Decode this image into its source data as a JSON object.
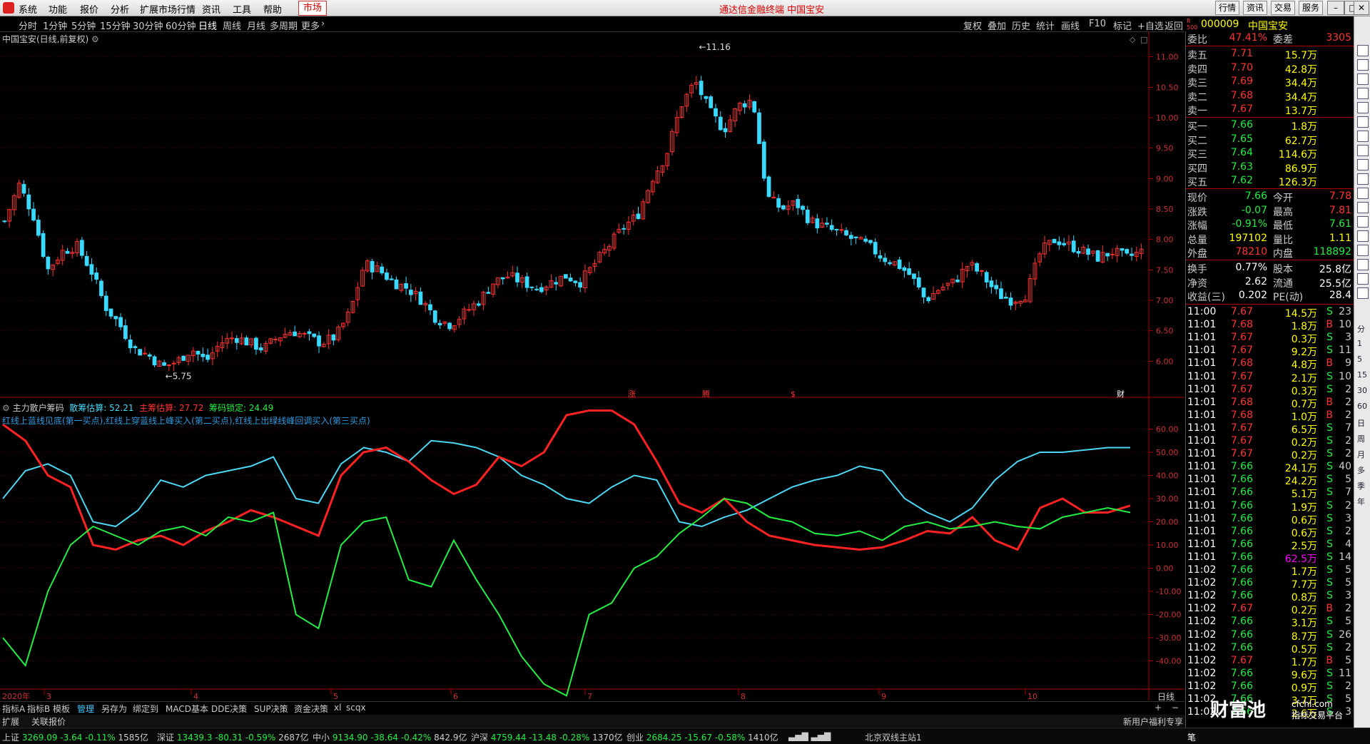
{
  "menubar": {
    "items": [
      "系统",
      "功能",
      "报价",
      "分析",
      "扩展市场行情",
      "资讯",
      "工具",
      "帮助"
    ],
    "market_tab": "市场",
    "title": "通达信金融终端  中国宝安",
    "right_buttons": [
      "行情",
      "资讯",
      "交易",
      "服务"
    ]
  },
  "periodbar": {
    "periods": [
      "分时",
      "1分钟",
      "5分钟",
      "15分钟",
      "30分钟",
      "60分钟",
      "日线",
      "周线",
      "月线",
      "多周期",
      "更多"
    ],
    "active": "日线",
    "right_items": [
      "复权",
      "叠加",
      "历史",
      "统计",
      "画线",
      "F10",
      "标记",
      "+自选",
      "返回"
    ]
  },
  "main_chart": {
    "title": "中国宝安(日线,前复权)",
    "high_label": "11.16",
    "low_label": "5.75",
    "price_axis": [
      "11.00",
      "10.50",
      "10.00",
      "9.50",
      "9.00",
      "8.50",
      "8.00",
      "7.50",
      "7.00",
      "6.50",
      "6.00"
    ],
    "event_marks": [
      "涨",
      "腾",
      "$",
      "财"
    ]
  },
  "chart_data": [
    {
      "type": "candlestick",
      "title": "中国宝安(日线,前复权)",
      "ylim": [
        5.5,
        11.3
      ],
      "note_points": {
        "high": 11.16,
        "low": 5.75
      },
      "close_path": [
        8.3,
        8.9,
        8.4,
        7.5,
        7.8,
        7.9,
        7.5,
        6.9,
        6.6,
        6.2,
        6.1,
        5.9,
        6.0,
        6.2,
        6.0,
        6.3,
        6.4,
        6.3,
        6.2,
        6.4,
        6.5,
        6.4,
        6.3,
        6.4,
        6.8,
        7.6,
        7.5,
        7.3,
        7.2,
        7.0,
        6.7,
        6.6,
        6.8,
        7.0,
        7.3,
        7.4,
        7.3,
        7.2,
        7.3,
        7.4,
        7.3,
        7.6,
        7.9,
        8.2,
        8.4,
        9.0,
        9.4,
        10.2,
        10.6,
        10.1,
        9.8,
        10.2,
        10.3,
        8.7,
        8.5,
        8.6,
        8.3,
        8.2,
        8.1,
        8.0,
        7.9,
        7.7,
        7.6,
        7.4,
        7.0,
        7.2,
        7.3,
        7.6,
        7.4,
        7.1,
        7.0,
        7.1,
        7.8,
        8.0,
        7.9,
        7.8,
        7.7,
        7.8,
        7.7,
        7.8
      ]
    },
    {
      "type": "line",
      "title": "主力散户筹码",
      "ylim": [
        -50,
        70
      ],
      "ticks": [
        "60.00",
        "50.00",
        "40.00",
        "30.00",
        "20.00",
        "10.00",
        "0.00",
        "-10.00",
        "-20.00",
        "-30.00",
        "-40.00"
      ],
      "series": [
        {
          "name": "散筹估算",
          "color": "#4cd7f5",
          "last": 52.21,
          "values": [
            30,
            42,
            45,
            40,
            20,
            18,
            25,
            38,
            35,
            40,
            42,
            44,
            48,
            30,
            28,
            45,
            52,
            50,
            46,
            55,
            54,
            52,
            48,
            40,
            36,
            30,
            28,
            35,
            40,
            38,
            20,
            18,
            22,
            25,
            30,
            35,
            38,
            40,
            44,
            42,
            30,
            24,
            20,
            26,
            38,
            46,
            50,
            50,
            51,
            52,
            52
          ]
        },
        {
          "name": "主筹估算",
          "color": "#ff2222",
          "last": 27.72,
          "values": [
            62,
            55,
            40,
            35,
            10,
            8,
            12,
            14,
            10,
            16,
            20,
            25,
            22,
            18,
            14,
            40,
            50,
            52,
            46,
            38,
            32,
            36,
            48,
            44,
            50,
            66,
            68,
            68,
            62,
            46,
            28,
            24,
            30,
            20,
            14,
            12,
            10,
            9,
            8,
            9,
            12,
            16,
            15,
            22,
            12,
            8,
            26,
            30,
            24,
            24,
            27
          ]
        },
        {
          "name": "筹码锁定",
          "color": "#22ee44",
          "last": 24.49,
          "values": [
            -30,
            -42,
            -10,
            10,
            18,
            14,
            10,
            16,
            18,
            14,
            22,
            20,
            24,
            -20,
            -26,
            10,
            20,
            22,
            -5,
            -8,
            12,
            -5,
            -20,
            -38,
            -50,
            -55,
            -20,
            -15,
            0,
            5,
            15,
            22,
            30,
            28,
            22,
            20,
            15,
            14,
            16,
            12,
            18,
            20,
            17,
            18,
            20,
            18,
            17,
            22,
            24,
            26,
            24
          ]
        }
      ]
    }
  ],
  "indicator": {
    "name": "主力散户筹码",
    "retail_label": "散筹估算:",
    "retail_value": "52.21",
    "main_label": "主筹估算:",
    "main_value": "27.72",
    "lock_label": "筹码锁定:",
    "lock_value": "24.49",
    "description": "红线上蓝线见底(第一买点),红线上穿蓝线上峰买入(第二买点),红线上出绿线峰回调买入(第三买点)"
  },
  "x_axis": {
    "year": "2020年",
    "months": [
      "3",
      "4",
      "5",
      "6",
      "7",
      "8",
      "9",
      "10"
    ],
    "period_label": "日线"
  },
  "tool_tabs": [
    "指标A",
    "指标B",
    "模板",
    "管理",
    "另存为",
    "绑定到",
    "MACD基本",
    "DDE决策",
    "SUP决策",
    "资金决策",
    "xl",
    "scqx"
  ],
  "tool_tab_active": "管理",
  "ext_bar": [
    "扩展",
    "关联报价"
  ],
  "quote_panel": {
    "code": "000009",
    "name": "中国宝安",
    "wb_label": "委比",
    "wb_value": "47.41%",
    "wc_label": "委差",
    "wc_value": "3305",
    "asks": [
      {
        "label": "卖五",
        "price": "7.71",
        "vol": "15.7万"
      },
      {
        "label": "卖四",
        "price": "7.70",
        "vol": "42.8万"
      },
      {
        "label": "卖三",
        "price": "7.69",
        "vol": "34.4万"
      },
      {
        "label": "卖二",
        "price": "7.68",
        "vol": "34.4万"
      },
      {
        "label": "卖一",
        "price": "7.67",
        "vol": "13.7万"
      }
    ],
    "bids": [
      {
        "label": "买一",
        "price": "7.66",
        "vol": "1.8万"
      },
      {
        "label": "买二",
        "price": "7.65",
        "vol": "62.7万"
      },
      {
        "label": "买三",
        "price": "7.64",
        "vol": "114.6万"
      },
      {
        "label": "买四",
        "price": "7.63",
        "vol": "86.9万"
      },
      {
        "label": "买五",
        "price": "7.62",
        "vol": "126.3万"
      }
    ],
    "stats": [
      {
        "l1": "现价",
        "v1": "7.66",
        "l2": "今开",
        "v2": "7.78"
      },
      {
        "l1": "涨跌",
        "v1": "-0.07",
        "l2": "最高",
        "v2": "7.81"
      },
      {
        "l1": "涨幅",
        "v1": "-0.91%",
        "l2": "最低",
        "v2": "7.61"
      },
      {
        "l1": "总量",
        "v1": "197102",
        "l2": "量比",
        "v2": "1.11"
      },
      {
        "l1": "外盘",
        "v1": "78210",
        "l2": "内盘",
        "v2": "118892"
      }
    ],
    "stats2": [
      {
        "l1": "换手",
        "v1": "0.77%",
        "l2": "股本",
        "v2": "25.8亿"
      },
      {
        "l1": "净资",
        "v1": "2.62",
        "l2": "流通",
        "v2": "25.5亿"
      },
      {
        "l1": "收益(三)",
        "v1": "0.202",
        "l2": "PE(动)",
        "v2": "28.4"
      }
    ],
    "ticks": [
      {
        "t": "11:00",
        "p": "7.67",
        "v": "14.5万",
        "s": "S",
        "n": "23"
      },
      {
        "t": "11:01",
        "p": "7.68",
        "v": "1.8万",
        "s": "B",
        "n": "10"
      },
      {
        "t": "11:01",
        "p": "7.67",
        "v": "0.3万",
        "s": "S",
        "n": "3"
      },
      {
        "t": "11:01",
        "p": "7.67",
        "v": "9.2万",
        "s": "S",
        "n": "11"
      },
      {
        "t": "11:01",
        "p": "7.68",
        "v": "4.8万",
        "s": "B",
        "n": "9"
      },
      {
        "t": "11:01",
        "p": "7.67",
        "v": "2.1万",
        "s": "S",
        "n": "10"
      },
      {
        "t": "11:01",
        "p": "7.67",
        "v": "0.3万",
        "s": "S",
        "n": "2"
      },
      {
        "t": "11:01",
        "p": "7.68",
        "v": "0.7万",
        "s": "B",
        "n": "2"
      },
      {
        "t": "11:01",
        "p": "7.68",
        "v": "1.0万",
        "s": "B",
        "n": "2"
      },
      {
        "t": "11:01",
        "p": "7.67",
        "v": "6.5万",
        "s": "S",
        "n": "7"
      },
      {
        "t": "11:01",
        "p": "7.67",
        "v": "0.2万",
        "s": "S",
        "n": "2"
      },
      {
        "t": "11:01",
        "p": "7.67",
        "v": "0.2万",
        "s": "S",
        "n": "2"
      },
      {
        "t": "11:01",
        "p": "7.66",
        "v": "24.1万",
        "s": "S",
        "n": "40"
      },
      {
        "t": "11:01",
        "p": "7.66",
        "v": "24.2万",
        "s": "S",
        "n": "5"
      },
      {
        "t": "11:01",
        "p": "7.66",
        "v": "5.1万",
        "s": "S",
        "n": "7"
      },
      {
        "t": "11:01",
        "p": "7.66",
        "v": "1.9万",
        "s": "S",
        "n": "2"
      },
      {
        "t": "11:01",
        "p": "7.66",
        "v": "0.6万",
        "s": "S",
        "n": "3"
      },
      {
        "t": "11:01",
        "p": "7.66",
        "v": "0.6万",
        "s": "S",
        "n": "2"
      },
      {
        "t": "11:01",
        "p": "7.66",
        "v": "2.5万",
        "s": "S",
        "n": "4"
      },
      {
        "t": "11:01",
        "p": "7.66",
        "v": "62.5万",
        "s": "S",
        "n": "14"
      },
      {
        "t": "11:02",
        "p": "7.66",
        "v": "1.7万",
        "s": "S",
        "n": "5"
      },
      {
        "t": "11:02",
        "p": "7.66",
        "v": "7.7万",
        "s": "S",
        "n": "5"
      },
      {
        "t": "11:02",
        "p": "7.66",
        "v": "0.8万",
        "s": "S",
        "n": "3"
      },
      {
        "t": "11:02",
        "p": "7.67",
        "v": "0.2万",
        "s": "B",
        "n": "2"
      },
      {
        "t": "11:02",
        "p": "7.66",
        "v": "3.1万",
        "s": "S",
        "n": "5"
      },
      {
        "t": "11:02",
        "p": "7.66",
        "v": "8.7万",
        "s": "S",
        "n": "26"
      },
      {
        "t": "11:02",
        "p": "7.66",
        "v": "0.5万",
        "s": "S",
        "n": "2"
      },
      {
        "t": "11:02",
        "p": "7.67",
        "v": "1.7万",
        "s": "B",
        "n": "5"
      },
      {
        "t": "11:02",
        "p": "7.66",
        "v": "9.6万",
        "s": "S",
        "n": "11"
      },
      {
        "t": "11:02",
        "p": "7.66",
        "v": "0.9万",
        "s": "S",
        "n": "2"
      },
      {
        "t": "11:02",
        "p": "7.66",
        "v": "3.7万",
        "s": "S",
        "n": "5"
      },
      {
        "t": "11:02",
        "p": "7.66",
        "v": "2.6万",
        "s": "S",
        "n": "3"
      }
    ]
  },
  "right_toolbar_labels": [
    "分",
    "1",
    "5",
    "15",
    "30",
    "60",
    "日",
    "周",
    "月",
    "多",
    "季",
    "年"
  ],
  "status_bar": {
    "items": [
      {
        "name": "上证",
        "v": "3269.09",
        "c": "-3.64",
        "p": "-0.11%",
        "a": "1585亿"
      },
      {
        "name": "深证",
        "v": "13439.3",
        "c": "-80.31",
        "p": "-0.59%",
        "a": "2687亿"
      },
      {
        "name": "中小",
        "v": "9134.90",
        "c": "-38.64",
        "p": "-0.42%",
        "a": "842.9亿"
      },
      {
        "name": "沪深",
        "v": "4759.44",
        "c": "-13.48",
        "p": "-0.28%",
        "a": "1370亿"
      },
      {
        "name": "创业",
        "v": "2684.25",
        "c": "-15.67",
        "p": "-0.58%",
        "a": "1410亿"
      }
    ],
    "server": "北京双线主站1",
    "promo": "新用户福利专享",
    "mode": "笔"
  },
  "watermark": {
    "main": "财富池",
    "sub": "cfchi.com",
    "sub2": "指标交易平台"
  }
}
